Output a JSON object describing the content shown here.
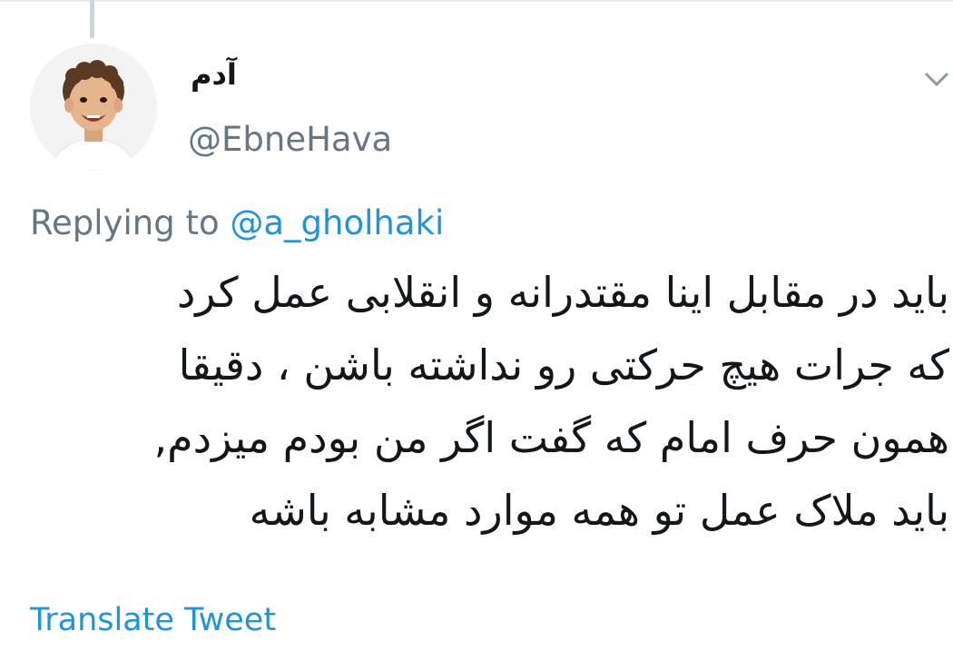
{
  "tweet": {
    "author": {
      "display_name": "آدم",
      "handle": "@EbneHava",
      "avatar_icon": "avatar-photo"
    },
    "menu_icon": "chevron-down-icon",
    "reply": {
      "prefix": "Replying to",
      "mention": "@a_gholhaki"
    },
    "text_lines": [
      "باید در مقابل اینا مقتدرانه و انقلابی عمل کرد",
      "که جرات هیچ حرکتی رو نداشته باشن ، دقیقا",
      "همون حرف امام که گفت اگر من بودم میزدم,",
      "باید ملاک عمل تو همه موارد مشابه باشه"
    ],
    "translate_label": "Translate Tweet"
  },
  "colors": {
    "text_primary": "#14171a",
    "text_secondary": "#657786",
    "link": "#1b95e0",
    "thread_line": "#cdd6dc"
  }
}
